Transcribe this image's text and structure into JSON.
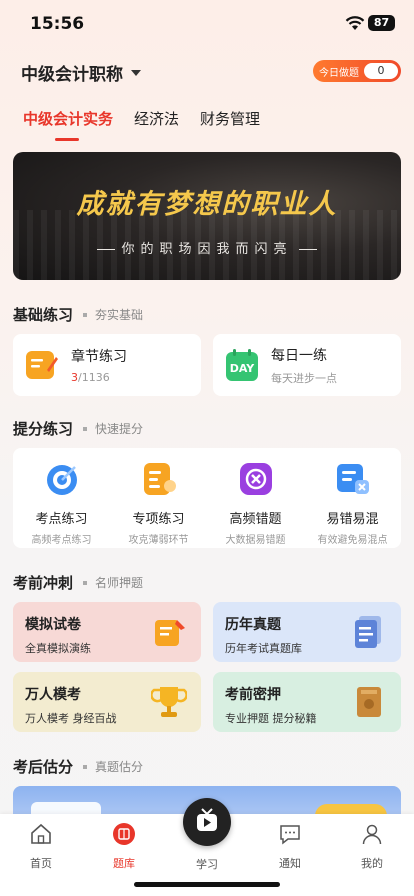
{
  "status_bar": {
    "time": "15:56",
    "battery": "87"
  },
  "header": {
    "exam_name": "中级会计职称",
    "daily_label": "今日做题",
    "daily_count": "0"
  },
  "tabs": [
    "中级会计实务",
    "经济法",
    "财务管理"
  ],
  "banner": {
    "headline": "成就有梦想的职业人",
    "subline": "你的职场因我而闪亮"
  },
  "basic": {
    "title": "基础练习",
    "subtitle": "夯实基础",
    "chapter": {
      "label": "章节练习",
      "done": "3",
      "total": "/1136"
    },
    "daily": {
      "label": "每日一练",
      "desc": "每天进步一点",
      "icon_text": "DAY"
    }
  },
  "boost": {
    "title": "提分练习",
    "subtitle": "快速提分",
    "items": [
      {
        "label": "考点练习",
        "desc": "高频考点练习"
      },
      {
        "label": "专项练习",
        "desc": "攻克薄弱环节"
      },
      {
        "label": "高频错题",
        "desc": "大数据易错题"
      },
      {
        "label": "易错易混",
        "desc": "有效避免易混点"
      }
    ]
  },
  "sprint": {
    "title": "考前冲刺",
    "subtitle": "名师押题",
    "cards": [
      {
        "label": "模拟试卷",
        "desc": "全真模拟演练"
      },
      {
        "label": "历年真题",
        "desc": "历年考试真题库"
      },
      {
        "label": "万人模考",
        "desc": "万人模考 身经百战"
      },
      {
        "label": "考前密押",
        "desc": "专业押题 提分秘籍"
      }
    ]
  },
  "estimate": {
    "title": "考后估分",
    "subtitle": "真题估分"
  },
  "tabbar": {
    "home": "首页",
    "bank": "题库",
    "study": "学习",
    "notice": "通知",
    "mine": "我的"
  },
  "colors": {
    "accent": "#e8362a",
    "banner_gold": "#f5c84c"
  }
}
